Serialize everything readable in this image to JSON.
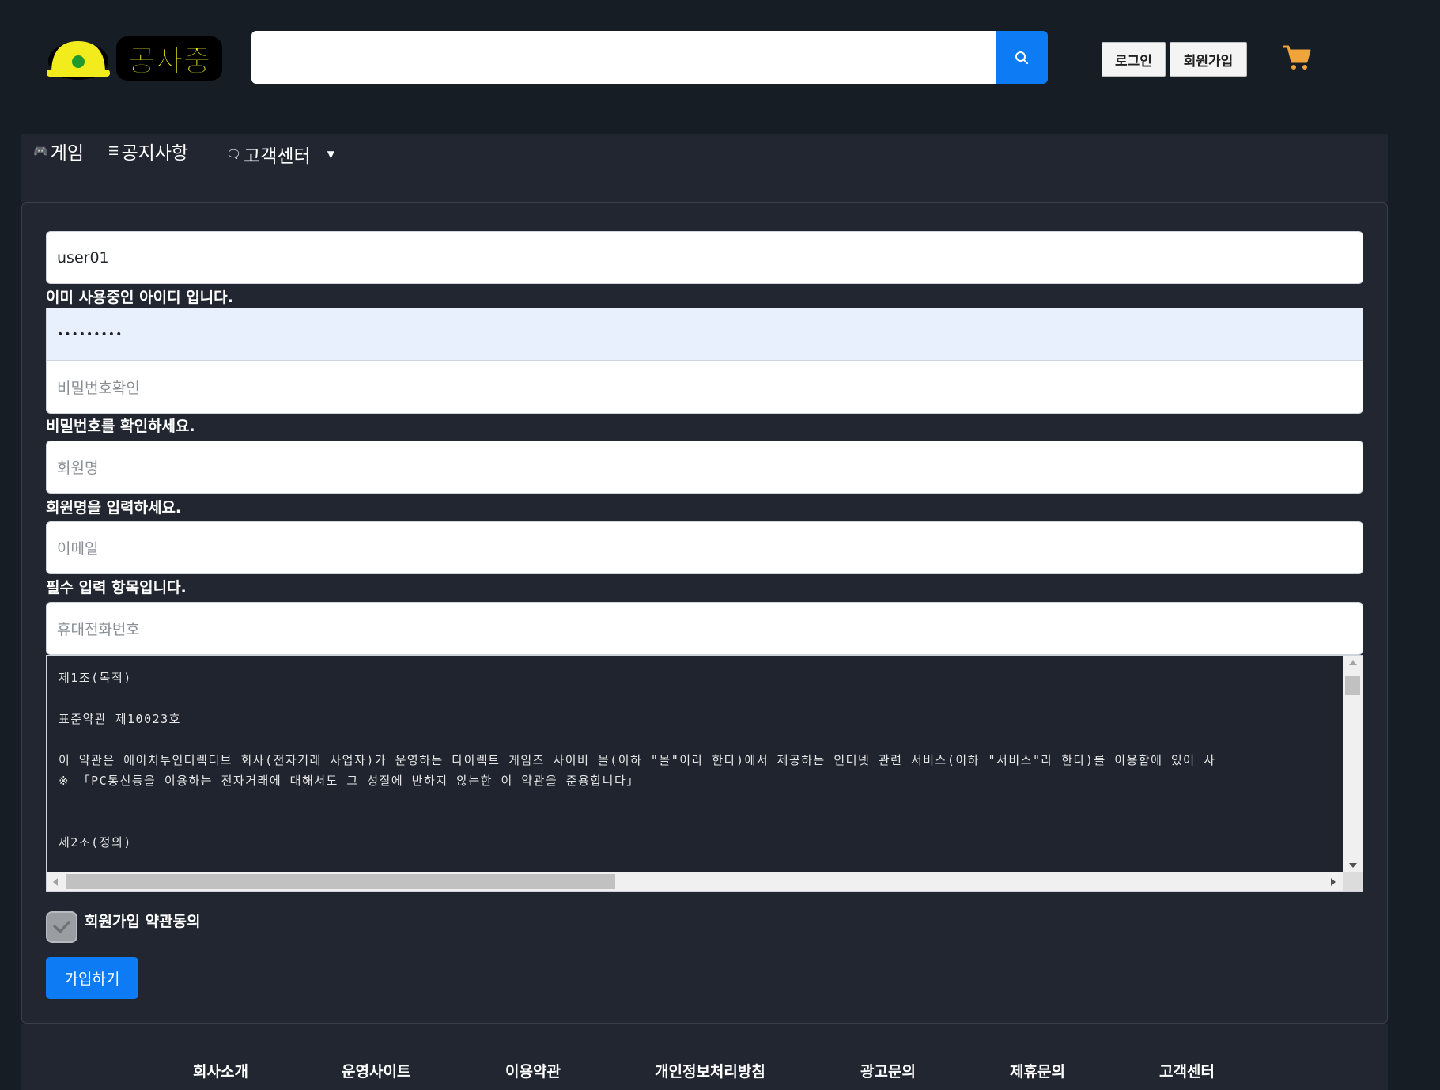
{
  "header": {
    "logo_text": "공사중",
    "search": {
      "value": "",
      "placeholder": ""
    },
    "login_label": "로그인",
    "signup_label": "회원가입"
  },
  "nav": {
    "items": [
      {
        "icon": "gamepad-icon",
        "label": "게임"
      },
      {
        "icon": "list-icon",
        "label": "공지사항"
      },
      {
        "icon": "chat-icon",
        "label": "고객센터",
        "dropdown": true
      }
    ]
  },
  "form": {
    "user_id": {
      "value": "user01",
      "help": "이미 사용중인 아이디 입니다."
    },
    "password": {
      "value": "•••••••••"
    },
    "password_confirm": {
      "placeholder": "비밀번호확인",
      "help": "비밀번호를 확인하세요."
    },
    "name": {
      "placeholder": "회원명",
      "help": "회원명을 입력하세요."
    },
    "email": {
      "placeholder": "이메일",
      "help": "필수 입력 항목입니다."
    },
    "phone": {
      "placeholder": "휴대전화번호"
    },
    "terms_text": "제1조(목적)\n\n표준약관 제10023호\n\n이 약관은 에이치투인터렉티브 회사(전자거래 사업자)가 운영하는 다이렉트 게임즈 사이버 몰(이하 \"몰\"이라 한다)에서 제공하는 인터넷 관련 서비스(이하 \"서비스\"라 한다)를 이용함에 있어 사\n※ 「PC통신등을 이용하는 전자거래에 대해서도 그 성질에 반하지 않는한 이 약관을 준용합니다」\n\n\n제2조(정의)",
    "agree_label": "회원가입 약관동의",
    "agree_checked": true,
    "submit_label": "가입하기"
  },
  "footer": {
    "links": [
      "회사소개",
      "운영사이트",
      "이용약관",
      "개인정보처리방침",
      "광고문의",
      "제휴문의",
      "고객센터"
    ]
  },
  "colors": {
    "accent": "#0d7bf3",
    "background": "#171d25",
    "panel": "#212630",
    "cart": "#f0a43a"
  }
}
